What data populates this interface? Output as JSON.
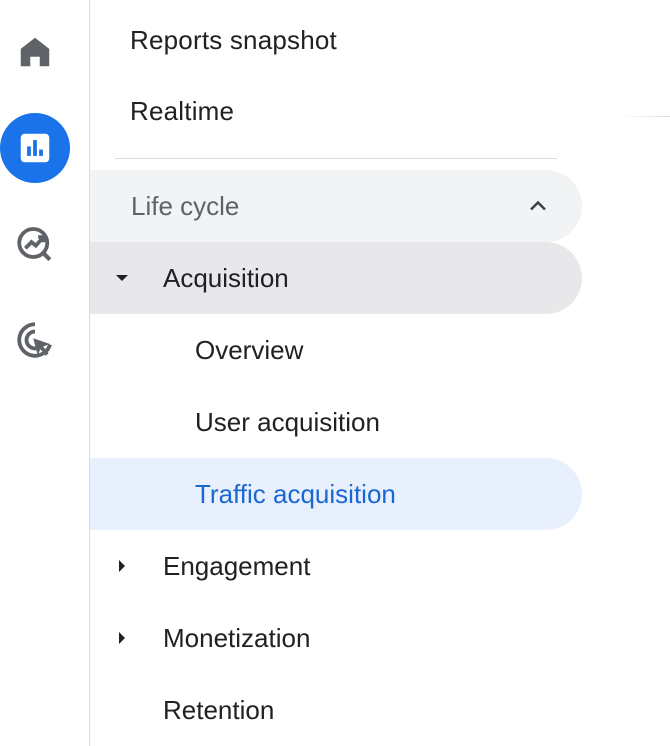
{
  "rail": {
    "items": [
      {
        "icon": "home-icon",
        "active": false
      },
      {
        "icon": "reports-icon",
        "active": true
      },
      {
        "icon": "explore-icon",
        "active": false
      },
      {
        "icon": "advertising-icon",
        "active": false
      }
    ],
    "accent_color": "#1a73e8"
  },
  "nav": {
    "reports_snapshot": "Reports snapshot",
    "realtime": "Realtime",
    "section": {
      "label": "Life cycle",
      "expanded": true
    },
    "groups": {
      "acquisition": {
        "label": "Acquisition",
        "expanded": true,
        "items": [
          {
            "label": "Overview",
            "active": false
          },
          {
            "label": "User acquisition",
            "active": false
          },
          {
            "label": "Traffic acquisition",
            "active": true
          }
        ]
      },
      "engagement": {
        "label": "Engagement",
        "expanded": false
      },
      "monetization": {
        "label": "Monetization",
        "expanded": false
      },
      "retention": {
        "label": "Retention"
      }
    }
  },
  "colors": {
    "active_item_bg": "#e8f0fe",
    "active_item_text": "#1967d2",
    "section_bg": "#f1f3f4",
    "expanded_group_bg": "#e8e8ea"
  }
}
